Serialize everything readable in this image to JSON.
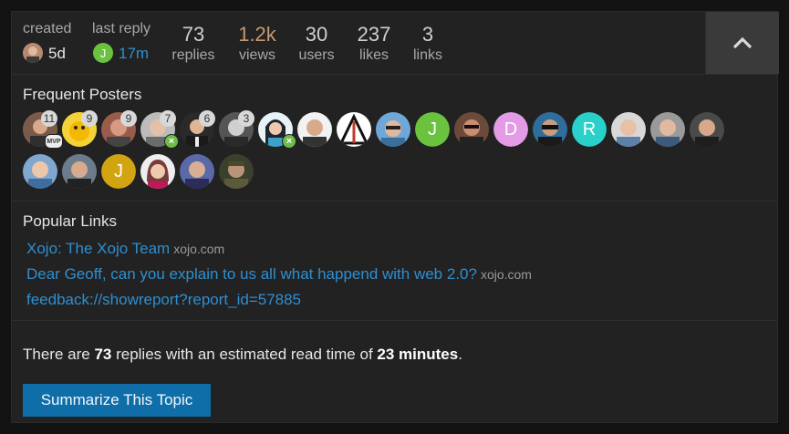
{
  "topic_map": {
    "created": {
      "label": "created",
      "value": "5d"
    },
    "last_reply": {
      "label": "last reply",
      "value": "17m",
      "avatar_letter": "J"
    },
    "stats": [
      {
        "key": "replies",
        "value": "73",
        "label": "replies",
        "color": "#cfcfcf"
      },
      {
        "key": "views",
        "value": "1.2k",
        "label": "views",
        "color": "#c59a6d"
      },
      {
        "key": "users",
        "value": "30",
        "label": "users",
        "color": "#cfcfcf"
      },
      {
        "key": "likes",
        "value": "237",
        "label": "likes",
        "color": "#cfcfcf"
      },
      {
        "key": "links",
        "value": "3",
        "label": "links",
        "color": "#cfcfcf"
      }
    ],
    "collapse_icon": "chevron-up-icon"
  },
  "frequent_posters": {
    "title": "Frequent Posters",
    "counts": [
      "11",
      "9",
      "9",
      "7",
      "6",
      "3"
    ],
    "badge_mvp": "MVP",
    "letters": {
      "j1": "J",
      "d": "D",
      "r": "R",
      "j2": "J"
    },
    "colors": {
      "j1": "#6bc23f",
      "d": "#e39be6",
      "r": "#2ad1c9",
      "j2": "#d2a411"
    }
  },
  "popular_links": {
    "title": "Popular Links",
    "items": [
      {
        "text": "Xojo: The Xojo Team",
        "domain": "xojo.com"
      },
      {
        "text": "Dear Geoff, can you explain to us all what happend with web 2.0?",
        "domain": "xojo.com"
      },
      {
        "text": "feedback://showreport?report_id=57885",
        "domain": ""
      }
    ]
  },
  "summary": {
    "prefix": "There are ",
    "replies": "73",
    "middle": " replies with an estimated read time of ",
    "time": "23 minutes",
    "suffix": ".",
    "button": "Summarize This Topic"
  }
}
